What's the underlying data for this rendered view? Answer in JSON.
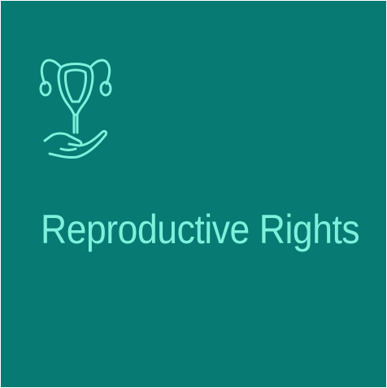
{
  "card": {
    "title": "Reproductive Rights",
    "icon": "uterus-in-hand-icon",
    "background_color": "#077a73",
    "accent_color": "#7ff0dc"
  }
}
